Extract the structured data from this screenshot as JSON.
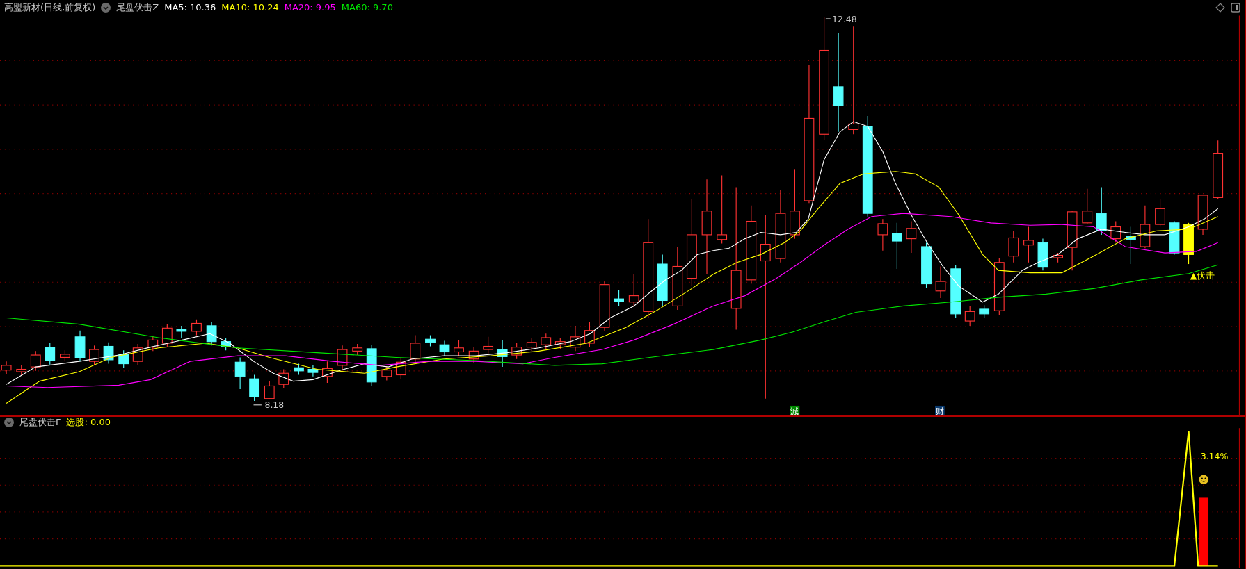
{
  "main_panel": {
    "title": "高盟新材(日线,前复权)",
    "indicator": "尾盘伏击Z",
    "moving_averages": [
      {
        "label": "MA5: 10.36",
        "color": "#ffffff"
      },
      {
        "label": "MA10: 10.24",
        "color": "#ffff00"
      },
      {
        "label": "MA20: 9.95",
        "color": "#ff00ff"
      },
      {
        "label": "MA60: 9.70",
        "color": "#00e600"
      }
    ],
    "high_label": "12.48",
    "low_label": "8.18",
    "signal_label": "▲伏击",
    "markers": [
      {
        "text": "減",
        "color": "#008a00"
      },
      {
        "text": "财",
        "color": "#0a3a6e"
      }
    ]
  },
  "sub_panel": {
    "indicator": "尾盘伏击F",
    "reading": "选股: 0.00",
    "percent_label": "3.14%"
  }
}
